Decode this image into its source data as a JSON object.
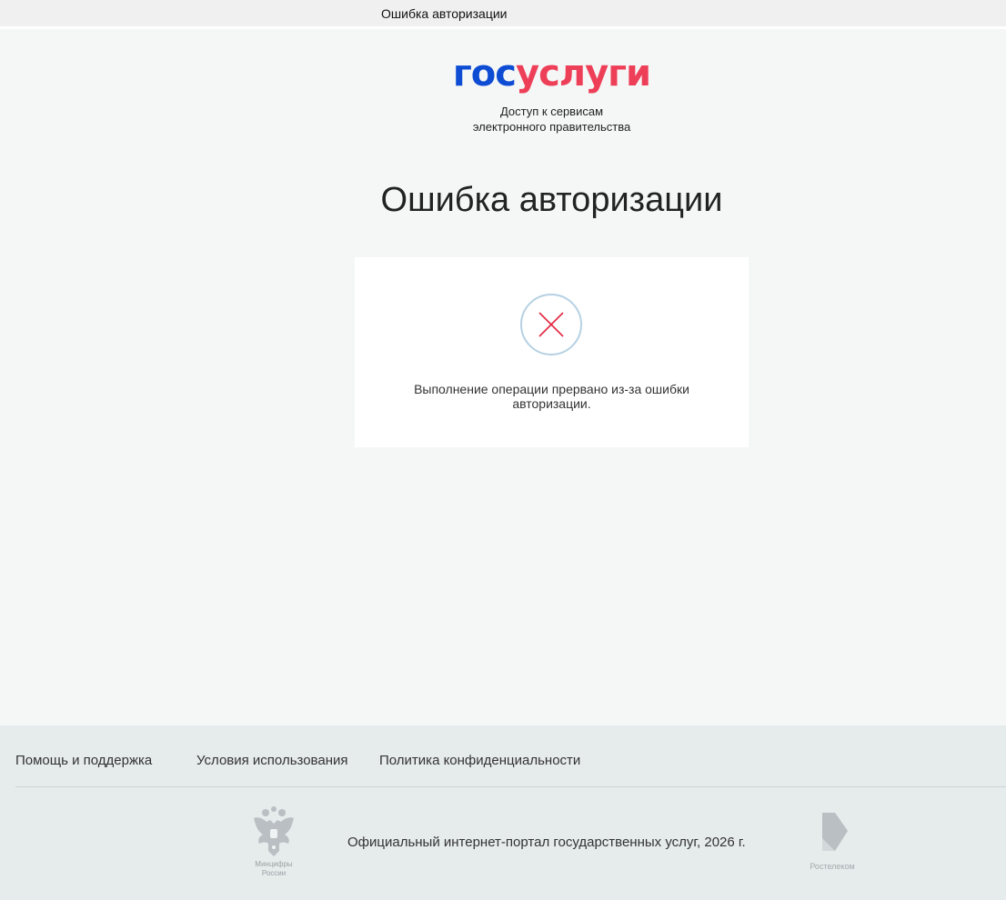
{
  "window": {
    "title": "Ошибка авторизации"
  },
  "logo": {
    "part1": "гос",
    "part2": "услуги"
  },
  "tagline": {
    "line1": "Доступ к сервисам",
    "line2": "электронного правительства"
  },
  "heading": "Ошибка авторизации",
  "card": {
    "icon": "close-x-icon",
    "message_line1": "Выполнение операции прервано из-за ошибки",
    "message_line2": "авторизации."
  },
  "footer": {
    "links": [
      "Помощь и поддержка",
      "Условия использования",
      "Политика конфиденциальности"
    ],
    "ministry": {
      "line1": "Минцифры",
      "line2": "России"
    },
    "copyright": "Официальный интернет-портал государственных услуг, 2026 г.",
    "partner": "Ростелеком"
  },
  "colors": {
    "brand_blue": "#0d4cd3",
    "brand_red": "#ee3f58",
    "error_red": "#e2263f",
    "circle_border": "#b6d1e3",
    "page_bg": "#f5f7f7",
    "footer_bg": "#e6ebec"
  }
}
